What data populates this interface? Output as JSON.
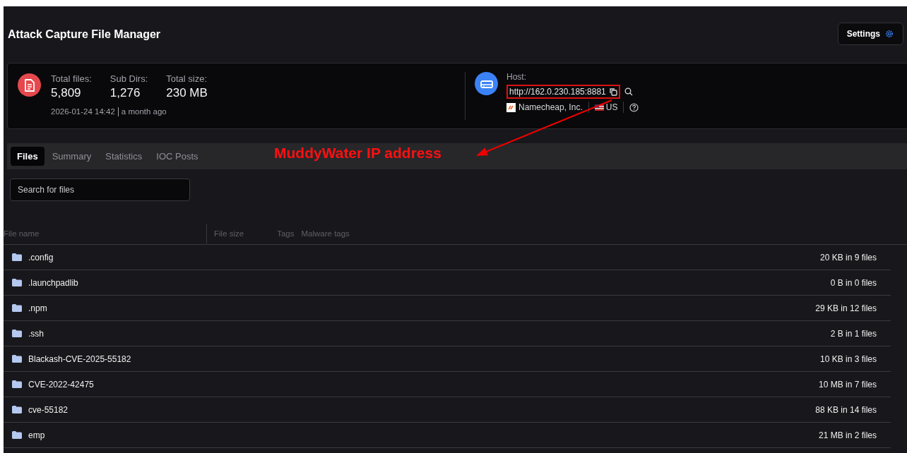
{
  "header": {
    "title": "Attack Capture File Manager",
    "settings_button": "Settings"
  },
  "summary": {
    "stats": [
      {
        "label": "Total files:",
        "value": "5,809"
      },
      {
        "label": "Sub Dirs:",
        "value": "1,276"
      },
      {
        "label": "Total size:",
        "value": "230 MB"
      }
    ],
    "date": "2026-01-24 14:42",
    "ago": "a month ago",
    "host": {
      "label": "Host:",
      "url": "http://162.0.230.185:8881",
      "provider": "Namecheap, Inc.",
      "country": "US"
    }
  },
  "tabs": [
    {
      "label": "Files",
      "selected": true
    },
    {
      "label": "Summary",
      "selected": false
    },
    {
      "label": "Statistics",
      "selected": false
    },
    {
      "label": "IOC Posts",
      "selected": false
    }
  ],
  "annotation": {
    "label": "MuddyWater IP address"
  },
  "search": {
    "placeholder": "Search for files"
  },
  "table": {
    "columns": [
      "File name",
      "File size",
      "Tags",
      "Malware tags"
    ],
    "rows": [
      {
        "name": ".config",
        "size": "20 KB in 9 files"
      },
      {
        "name": ".launchpadlib",
        "size": "0 B in 0 files"
      },
      {
        "name": ".npm",
        "size": "29 KB in 12 files"
      },
      {
        "name": ".ssh",
        "size": "2 B in 1 files"
      },
      {
        "name": "Blackash-CVE-2025-55182",
        "size": "10 KB in 3 files"
      },
      {
        "name": "CVE-2022-42475",
        "size": "10 MB in 7 files"
      },
      {
        "name": "cve-55182",
        "size": "88 KB in 14 files"
      },
      {
        "name": "emp",
        "size": "21 MB in 2 files"
      }
    ]
  }
}
